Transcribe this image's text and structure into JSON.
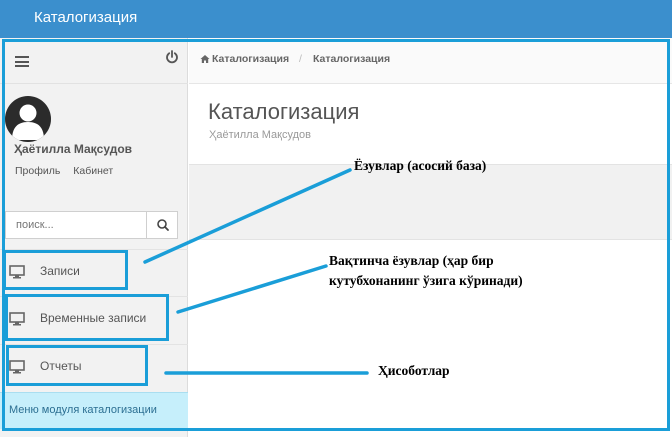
{
  "topbar": {
    "title": "Каталогизация"
  },
  "sidebar": {
    "user_name": "Ҳаётилла Мақсудов",
    "links": {
      "profile": "Профиль",
      "cabinet": "Кабинет"
    },
    "search": {
      "placeholder": "поиск..."
    },
    "items": [
      {
        "label": "Записи"
      },
      {
        "label": "Временные записи"
      },
      {
        "label": "Отчеты"
      }
    ],
    "footer": "Меню модуля каталогизации"
  },
  "breadcrumb": [
    "Каталогизация",
    "Каталогизация"
  ],
  "page": {
    "title": "Каталогизация",
    "subtitle": "Ҳаётилла Мақсудов"
  },
  "annotations": {
    "note1": "Ёзувлар (асосий база)",
    "note2": "Вақтинча  ёзувлар (ҳар бир кутубхонанинг ўзига кўринади)",
    "note3": "Ҳисоботлар"
  },
  "colors": {
    "topbar": "#3b8fcd",
    "highlight": "#1a9ed8",
    "footer": "#c6effb"
  }
}
